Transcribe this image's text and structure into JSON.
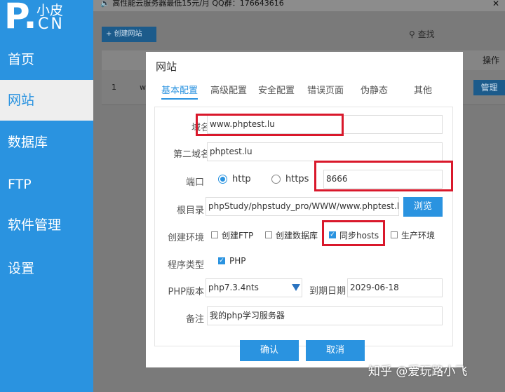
{
  "topbar": {
    "ad_text": "高性能云服务器最低15元/月  QQ群：176643616"
  },
  "logo": {
    "letter": "P.",
    "zh": "小皮",
    "cn": "CN"
  },
  "sidebar": {
    "items": [
      {
        "label": "首页",
        "active": false
      },
      {
        "label": "网站",
        "active": true
      },
      {
        "label": "数据库",
        "active": false
      },
      {
        "label": "FTP",
        "active": false
      },
      {
        "label": "软件管理",
        "active": false
      },
      {
        "label": "设置",
        "active": false
      }
    ]
  },
  "main": {
    "create_site_label": "+ 创建网站",
    "search_label": "查找",
    "table_header_operation": "操作",
    "row_index": "1",
    "row_domain_fragment": "w",
    "row_manage_label": "管理"
  },
  "dialog": {
    "title": "网站",
    "tabs": [
      "基本配置",
      "高级配置",
      "安全配置",
      "错误页面",
      "伪静态",
      "其他"
    ],
    "form": {
      "domain_label": "域名",
      "domain_value": "www.phptest.lu",
      "second_domain_label": "第二域名",
      "second_domain_value": "phptest.lu",
      "port_label": "端口",
      "http_label": "http",
      "https_label": "https",
      "port_value": "8666",
      "root_label": "根目录",
      "root_value": "phpStudy/phpstudy_pro/WWW/www.phptest.lu",
      "browse_label": "浏览",
      "env_label": "创建环境",
      "env_options": [
        {
          "label": "创建FTP",
          "checked": false
        },
        {
          "label": "创建数据库",
          "checked": false
        },
        {
          "label": "同步hosts",
          "checked": true
        },
        {
          "label": "生产环境",
          "checked": false
        }
      ],
      "program_type_label": "程序类型",
      "program_type_value": "PHP",
      "php_version_label": "PHP版本",
      "php_version_value": "php7.3.4nts",
      "expiry_label": "到期日期",
      "expiry_value": "2029-06-18",
      "note_label": "备注",
      "note_value": "我的php学习服务器"
    },
    "confirm_label": "确认",
    "cancel_label": "取消"
  },
  "watermark": "知乎 @爱玩路小飞",
  "colors": {
    "accent": "#2a93e0",
    "highlight": "#d9182b"
  }
}
